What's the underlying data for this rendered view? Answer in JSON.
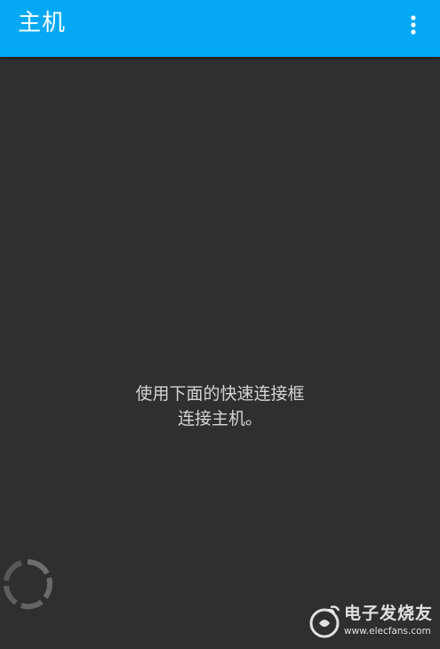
{
  "app_bar": {
    "title": "主机",
    "menu_icon": "more-vert-icon",
    "color": "#03a9f4"
  },
  "empty_state": {
    "line1": "使用下面的快速连接框",
    "line2": "连接主机。"
  },
  "quick_connect": {
    "icon": "loading-spinner-icon"
  },
  "watermark": {
    "title": "电子发烧友",
    "url": "www.elecfans.com",
    "logo": "elecfans-logo-icon"
  },
  "colors": {
    "background": "#2f2f2f",
    "text": "#d4d4d4",
    "accent": "#03a9f4"
  }
}
